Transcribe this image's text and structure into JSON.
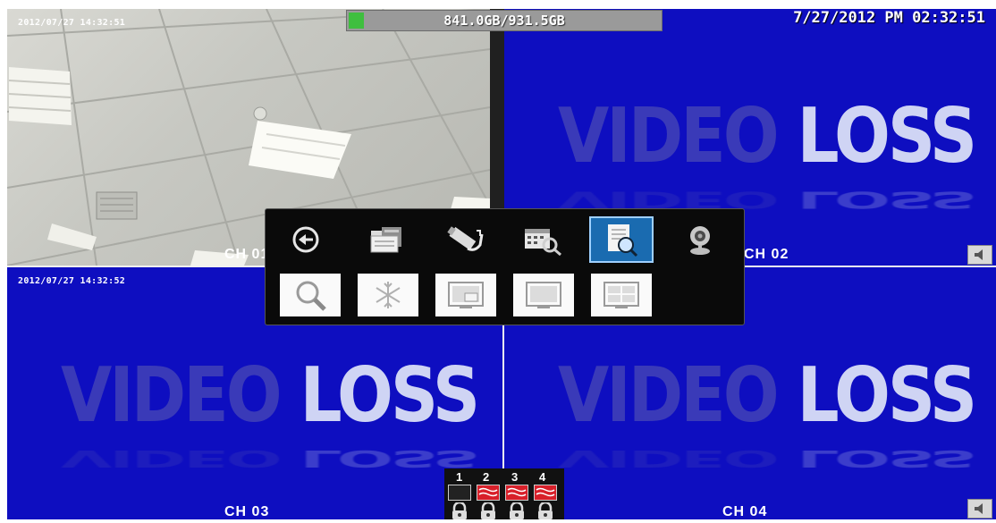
{
  "hdd": {
    "usage_text": "841.0GB/931.5GB",
    "used_fraction": 0.05
  },
  "datetime": "7/27/2012 PM 02:32:51",
  "channels": [
    {
      "label": "CH 01",
      "timestamp": "2012/07/27 14:32:51",
      "state": "live"
    },
    {
      "label": "CH 02",
      "timestamp": "",
      "state": "video-loss"
    },
    {
      "label": "CH 03",
      "timestamp": "2012/07/27 14:32:52",
      "state": "video-loss"
    },
    {
      "label": "CH 04",
      "timestamp": "",
      "state": "video-loss"
    }
  ],
  "video_loss": {
    "word1": "VIDEO",
    "word2": "LOSS"
  },
  "menu": {
    "row1": [
      "playback-icon",
      "folder-icon",
      "usb-backup-icon",
      "schedule-search-icon",
      "event-search-icon",
      "webcam-icon"
    ],
    "row2": [
      "zoom-icon",
      "freeze-icon",
      "pip-icon",
      "single-view-icon",
      "quad-view-icon"
    ],
    "selected": "event-search-icon"
  },
  "status_panel": {
    "channels": [
      "1",
      "2",
      "3",
      "4"
    ],
    "states": [
      "ok",
      "loss",
      "loss",
      "loss"
    ]
  },
  "colors": {
    "channel_bg": "#0e0ec0",
    "loss_red": "#d8202a",
    "hdd_green": "#3fbf3f"
  }
}
